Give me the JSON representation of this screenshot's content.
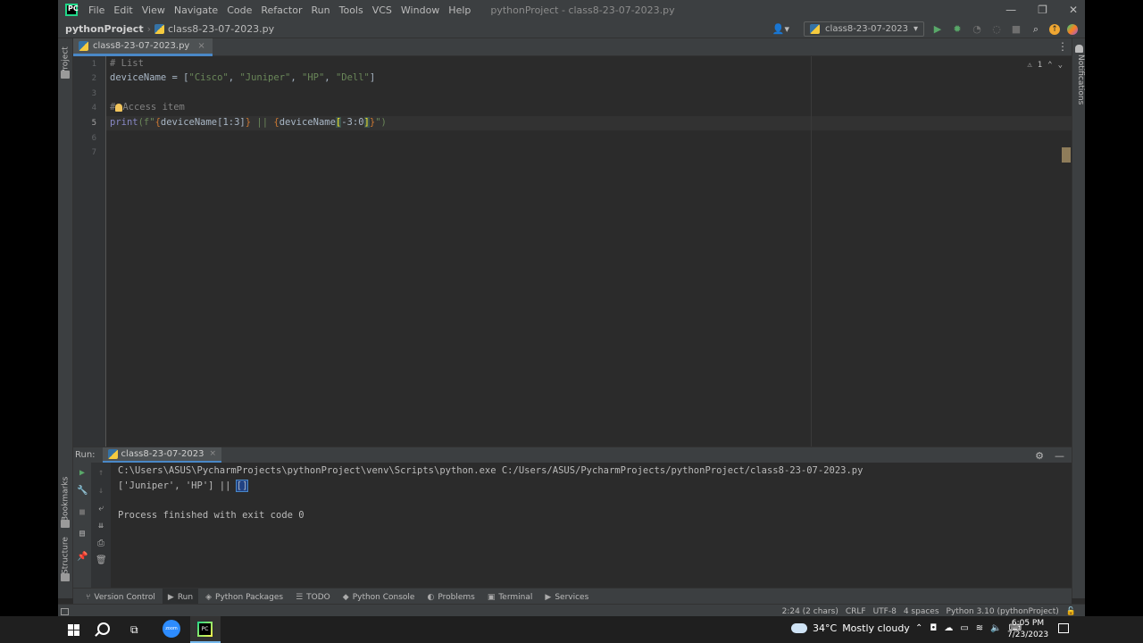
{
  "menubar": {
    "logo_text": "PC",
    "items": [
      "File",
      "Edit",
      "View",
      "Navigate",
      "Code",
      "Refactor",
      "Run",
      "Tools",
      "VCS",
      "Window",
      "Help"
    ],
    "title": "pythonProject - class8-23-07-2023.py",
    "controls": {
      "minimize": "—",
      "restore": "❐",
      "close": "✕"
    }
  },
  "navbar": {
    "project": "pythonProject",
    "file": "class8-23-07-2023.py",
    "run_config": "class8-23-07-2023"
  },
  "left_strip": {
    "project_tab": "Project",
    "bookmarks_tab": "Bookmarks",
    "structure_tab": "Structure"
  },
  "right_strip": {
    "notifications_tab": "Notifications"
  },
  "editor_tab": {
    "label": "class8-23-07-2023.py"
  },
  "editor": {
    "line_numbers": [
      "1",
      "2",
      "3",
      "4",
      "5",
      "6",
      "7"
    ],
    "current_line": 5,
    "inspection": {
      "warnings": "1"
    },
    "code": {
      "line1": "# List",
      "line2_a": "deviceName = [",
      "line2_s1": "\"Cisco\"",
      "line2_s2": "\"Juniper\"",
      "line2_s3": "\"HP\"",
      "line2_s4": "\"Dell\"",
      "line2_end": "]",
      "line4_a": "#",
      "line4_b": "Access item",
      "line5_fn": "print",
      "line5_open": "(f\"",
      "line5_b1": "{",
      "line5_e1": "deviceName[1:3]",
      "line5_b2": "}",
      "line5_mid": " || ",
      "line5_b3": "{",
      "line5_e2a": "deviceName",
      "line5_hl1": "[",
      "line5_e2b": "-3:0",
      "line5_hl2": "]",
      "line5_b4": "}",
      "line5_close": "\")"
    }
  },
  "run_panel": {
    "label": "Run:",
    "tab": "class8-23-07-2023",
    "output": {
      "cmd": "C:\\Users\\ASUS\\PycharmProjects\\pythonProject\\venv\\Scripts\\python.exe C:/Users/ASUS/PycharmProjects/pythonProject/class8-23-07-2023.py",
      "result_a": "['Juniper', 'HP'] || ",
      "result_sel": "[]",
      "finished": "Process finished with exit code 0"
    }
  },
  "tool_windows": [
    {
      "label": "Version Control",
      "icon": "⑂"
    },
    {
      "label": "Run",
      "icon": "▶"
    },
    {
      "label": "Python Packages",
      "icon": "◈"
    },
    {
      "label": "TODO",
      "icon": "☰"
    },
    {
      "label": "Python Console",
      "icon": "◆"
    },
    {
      "label": "Problems",
      "icon": "◐"
    },
    {
      "label": "Terminal",
      "icon": "▣"
    },
    {
      "label": "Services",
      "icon": "▶"
    }
  ],
  "statusbar": {
    "position": "2:24 (2 chars)",
    "line_sep": "CRLF",
    "encoding": "UTF-8",
    "indent": "4 spaces",
    "interpreter": "Python 3.10 (pythonProject)"
  },
  "taskbar": {
    "zoom_label": "zoom",
    "weather_temp": "34°C",
    "weather_desc": "Mostly cloudy",
    "time": "6:05 PM",
    "date": "7/23/2023"
  },
  "colors": {
    "accent": "#4a88c7",
    "run_green": "#59a869",
    "background": "#2b2b2b"
  }
}
